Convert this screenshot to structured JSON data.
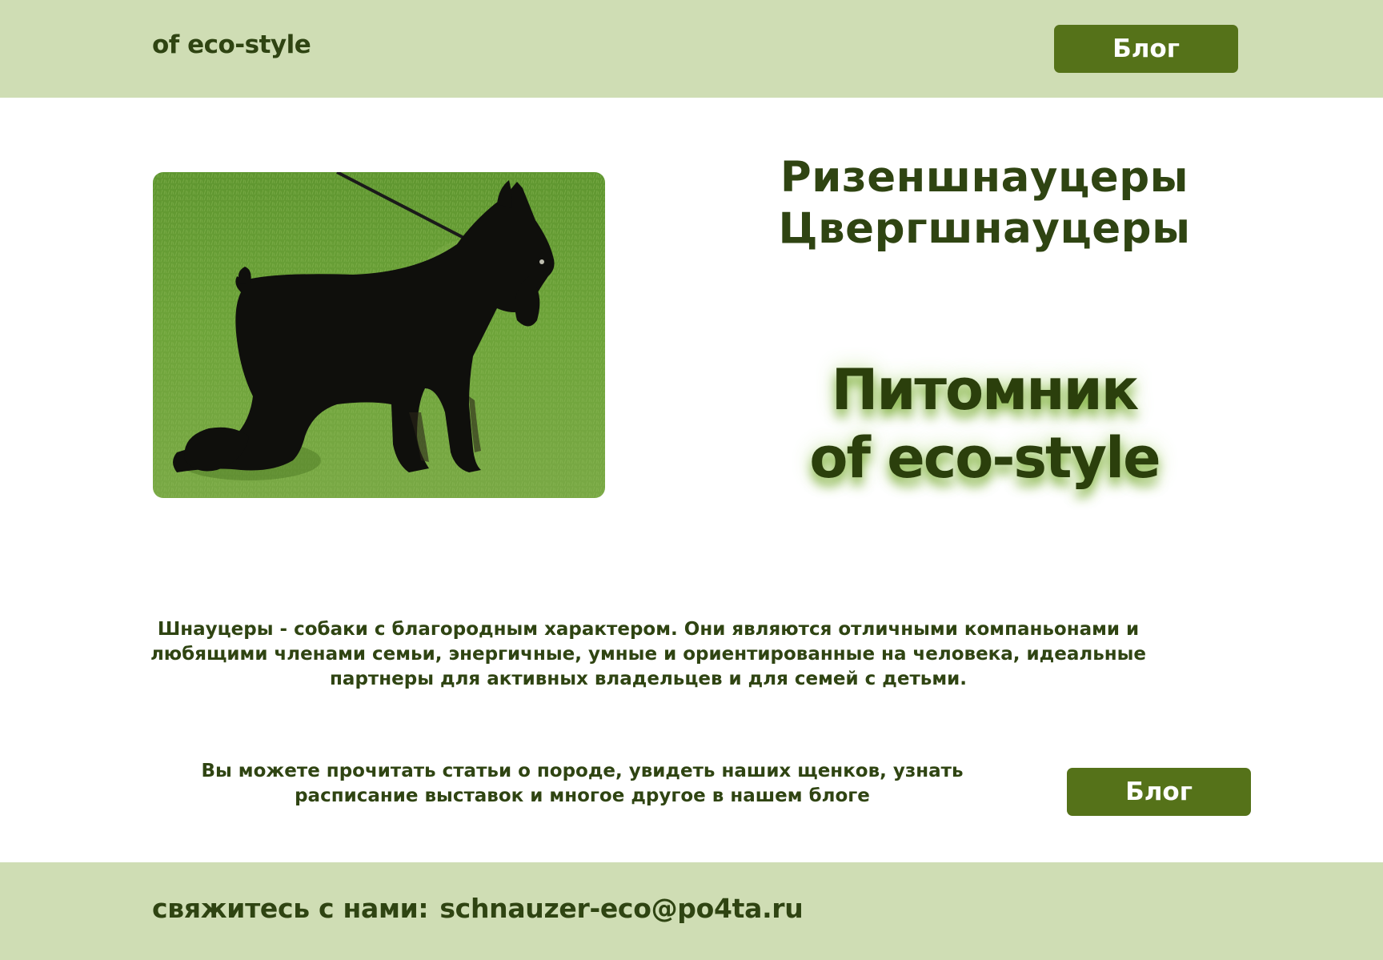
{
  "header": {
    "brand": "of eco-style",
    "blog_button": "Блог"
  },
  "hero": {
    "breed_1": "Ризеншнауцеры",
    "breed_2": "Цвергшнауцеры",
    "kennel_line_1": "Питомник",
    "kennel_line_2": "of eco-style",
    "photo_icon": "black-schnauzer-on-grass-photo"
  },
  "about": {
    "text": "Шнауцеры - собаки с благородным характером. Они являются отличными компаньонами и любящими членами семьи, энергичные, умные и ориентированные на человека, идеальные партнеры для активных владельцев и для семей с детьми."
  },
  "blog_section": {
    "text": "Вы можете прочитать статьи о породе,  увидеть наших щенков, узнать расписание выставок и многое другое в нашем блоге",
    "button": "Блог"
  },
  "footer": {
    "contact_label": "свяжитесь с нами:",
    "email": "schnauzer-eco@po4ta.ru"
  },
  "colors": {
    "band": "#cfddb4",
    "button": "#557219",
    "text": "#2f4412"
  }
}
